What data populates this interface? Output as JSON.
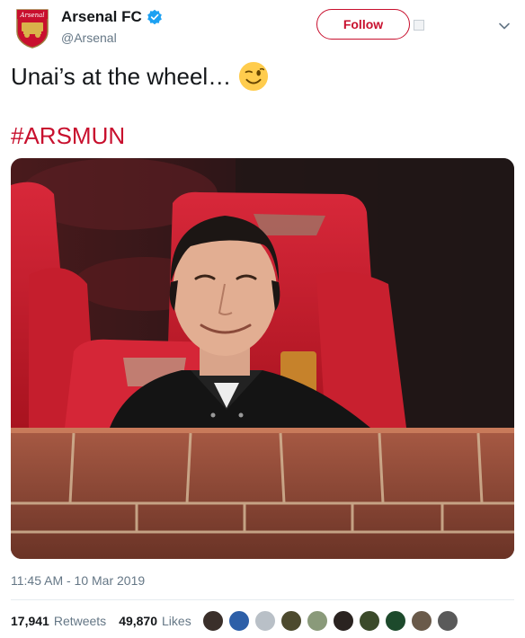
{
  "author": {
    "display_name": "Arsenal FC",
    "handle": "@Arsenal",
    "avatar_icon": "arsenal-crest-icon",
    "crest_text": "Arsenal",
    "verified_icon": "verified-badge-icon"
  },
  "header": {
    "follow_label": "Follow",
    "menu_icon": "chevron-down-icon"
  },
  "tweet": {
    "text": "Unai’s at the wheel…",
    "emoji_icon": "winking-face-emoji",
    "hashtag": "#ARSMUN",
    "photo_icon": "man-in-stadium-seat-photo"
  },
  "meta": {
    "timestamp": "11:45 AM - 10 Mar 2019"
  },
  "stats": {
    "retweets_count": "17,941",
    "retweets_label": "Retweets",
    "likes_count": "49,870",
    "likes_label": "Likes"
  },
  "likers": [
    {
      "color": "#3a2f2a"
    },
    {
      "color": "#2d5fa8"
    },
    {
      "color": "#b9c0c7"
    },
    {
      "color": "#4d4a2e"
    },
    {
      "color": "#8a9a7a"
    },
    {
      "color": "#2a2320"
    },
    {
      "color": "#3b4a2a"
    },
    {
      "color": "#1d4a2c"
    },
    {
      "color": "#6a5a4a"
    },
    {
      "color": "#5a5a5a"
    }
  ],
  "colors": {
    "brand": "#c8102e",
    "muted": "#657786",
    "verified": "#1da1f2"
  }
}
